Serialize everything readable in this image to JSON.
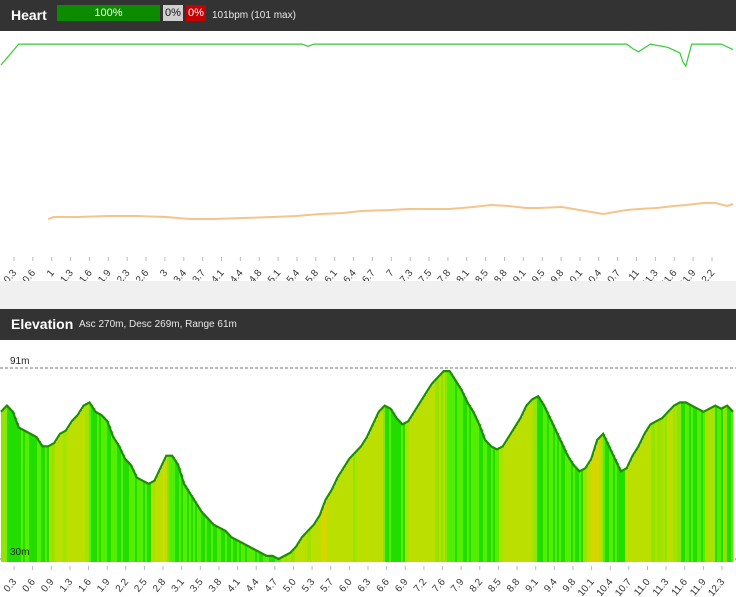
{
  "heart": {
    "title": "Heart",
    "zone_green": "100%",
    "zone_grey": "0%",
    "zone_red": "0%",
    "summary": "101bpm (101 max)"
  },
  "elevation": {
    "title": "Elevation",
    "summary": "Asc 270m, Desc 269m, Range 61m",
    "max_label": "91m",
    "min_label": "30m"
  },
  "colors": {
    "header_bg": "#333333",
    "heart_line": "#33cc33",
    "secondary_line": "#f5c48a",
    "elev_outline": "#1c8f00",
    "elev_fill_green": "#22dd00",
    "elev_fill_yellow": "#d6d600"
  },
  "chart_data": [
    {
      "type": "line",
      "title": "Heart",
      "x": [
        0.0,
        0.3,
        0.6,
        0.9,
        1.0,
        1.3,
        1.6,
        1.9,
        2.3,
        2.6,
        3.0,
        3.4,
        3.7,
        4.1,
        4.4,
        4.8,
        5.1,
        5.2,
        5.3,
        5.4,
        5.8,
        6.1,
        6.4,
        6.7,
        7.0,
        7.3,
        7.5,
        7.8,
        8.1,
        8.5,
        8.8,
        9.1,
        9.5,
        9.8,
        10.1,
        10.4,
        10.6,
        10.7,
        10.8,
        11.0,
        11.3,
        11.5,
        11.55,
        11.6,
        11.7,
        11.9,
        12.2,
        12.4
      ],
      "series": [
        {
          "name": "",
          "values": [
            81,
            100,
            100,
            100,
            100,
            100,
            100,
            100,
            100,
            100,
            100,
            100,
            100,
            100,
            100,
            100,
            100,
            98,
            100,
            100,
            100,
            100,
            100,
            100,
            100,
            100,
            100,
            100,
            100,
            100,
            100,
            100,
            100,
            100,
            100,
            100,
            100,
            96,
            93,
            100,
            97,
            92,
            84,
            80,
            100,
            100,
            100,
            95
          ]
        }
      ],
      "x_ticks": [
        "0.3",
        "0.6",
        "1",
        "1.3",
        "1.6",
        "1.9",
        "2.3",
        "2.6",
        "3",
        "3.4",
        "3.7",
        "4.1",
        "4.4",
        "4.8",
        "5.1",
        "5.4",
        "5.8",
        "6.1",
        "6.4",
        "6.7",
        "7",
        "7.3",
        "7.5",
        "7.8",
        "8.1",
        "8.5",
        "8.8",
        "9.1",
        "9.5",
        "9.8",
        "10.1",
        "10.4",
        "10.7",
        "11",
        "11.3",
        "11.6",
        "11.9",
        "12.2"
      ]
    },
    {
      "type": "line",
      "title": "",
      "x": [
        0.8,
        0.9,
        1.3,
        1.8,
        2.3,
        2.8,
        3.2,
        3.6,
        4.1,
        4.6,
        5.0,
        5.4,
        5.8,
        6.1,
        6.6,
        6.9,
        7.3,
        7.6,
        8.0,
        8.3,
        8.6,
        8.9,
        9.1,
        9.5,
        9.9,
        10.2,
        10.4,
        10.6,
        10.8,
        11.1,
        11.4,
        11.6,
        11.9,
        12.1,
        12.3,
        12.4
      ],
      "series": [
        {
          "name": "",
          "values": [
            88,
            90,
            90,
            91,
            91,
            90,
            88,
            88,
            89,
            90,
            91,
            93,
            94,
            96,
            97,
            98,
            98,
            98,
            100,
            102,
            101,
            99,
            99,
            100,
            96,
            93,
            95,
            97,
            98,
            99,
            101,
            102,
            104,
            104,
            101,
            103
          ]
        }
      ]
    },
    {
      "type": "area",
      "title": "Elevation",
      "ylim": [
        28,
        93
      ],
      "reference_lines": [
        91,
        30
      ],
      "x": [
        0.0,
        0.1,
        0.2,
        0.3,
        0.4,
        0.5,
        0.6,
        0.7,
        0.8,
        0.9,
        1.0,
        1.1,
        1.2,
        1.3,
        1.4,
        1.5,
        1.6,
        1.7,
        1.8,
        1.9,
        2.0,
        2.1,
        2.2,
        2.3,
        2.4,
        2.5,
        2.6,
        2.7,
        2.8,
        2.9,
        3.0,
        3.1,
        3.2,
        3.3,
        3.4,
        3.5,
        3.6,
        3.7,
        3.8,
        3.9,
        4.0,
        4.1,
        4.2,
        4.3,
        4.4,
        4.5,
        4.6,
        4.7,
        4.8,
        4.9,
        5.0,
        5.1,
        5.2,
        5.3,
        5.4,
        5.5,
        5.6,
        5.7,
        5.8,
        5.9,
        6.0,
        6.1,
        6.2,
        6.3,
        6.4,
        6.5,
        6.6,
        6.7,
        6.8,
        6.9,
        7.0,
        7.1,
        7.2,
        7.3,
        7.4,
        7.5,
        7.6,
        7.7,
        7.8,
        7.9,
        8.0,
        8.1,
        8.2,
        8.3,
        8.4,
        8.5,
        8.6,
        8.7,
        8.8,
        8.9,
        9.0,
        9.1,
        9.2,
        9.3,
        9.4,
        9.5,
        9.6,
        9.7,
        9.8,
        9.9,
        10.0,
        10.1,
        10.2,
        10.3,
        10.4,
        10.5,
        10.6,
        10.7,
        10.8,
        10.9,
        11.0,
        11.1,
        11.2,
        11.3,
        11.4,
        11.5,
        11.6,
        11.7,
        11.8,
        11.9,
        12.0,
        12.1,
        12.2,
        12.3,
        12.4
      ],
      "series": [
        {
          "name": "",
          "values": [
            77,
            79,
            77,
            72,
            71,
            70,
            69,
            66,
            66,
            67,
            70,
            71,
            74,
            76,
            79,
            80,
            77,
            76,
            74,
            69,
            66,
            62,
            60,
            56,
            55,
            54,
            55,
            59,
            63,
            63,
            60,
            54,
            51,
            48,
            45,
            43,
            41,
            40,
            39,
            37,
            36,
            35,
            34,
            33,
            32,
            31,
            31,
            30,
            31,
            32,
            34,
            37,
            39,
            41,
            44,
            49,
            52,
            56,
            59,
            62,
            64,
            66,
            69,
            73,
            77,
            79,
            78,
            75,
            73,
            74,
            77,
            80,
            83,
            86,
            88,
            90,
            90,
            87,
            84,
            80,
            77,
            73,
            68,
            66,
            65,
            66,
            69,
            72,
            75,
            79,
            81,
            82,
            79,
            75,
            71,
            67,
            63,
            60,
            58,
            59,
            62,
            68,
            70,
            66,
            62,
            58,
            59,
            63,
            66,
            70,
            73,
            74,
            75,
            77,
            79,
            80,
            80,
            79,
            78,
            77,
            78,
            79,
            78,
            79,
            77
          ]
        }
      ],
      "x_ticks": [
        "0.3",
        "0.6",
        "0.9",
        "1.3",
        "1.6",
        "1.9",
        "2.2",
        "2.5",
        "2.8",
        "3.1",
        "3.5",
        "3.8",
        "4.1",
        "4.4",
        "4.7",
        "5.0",
        "5.3",
        "5.7",
        "6.0",
        "6.3",
        "6.6",
        "6.9",
        "7.2",
        "7.6",
        "7.9",
        "8.2",
        "8.5",
        "8.8",
        "9.1",
        "9.4",
        "9.8",
        "10.1",
        "10.4",
        "10.7",
        "11.0",
        "11.3",
        "11.6",
        "11.9",
        "12.3"
      ]
    }
  ]
}
